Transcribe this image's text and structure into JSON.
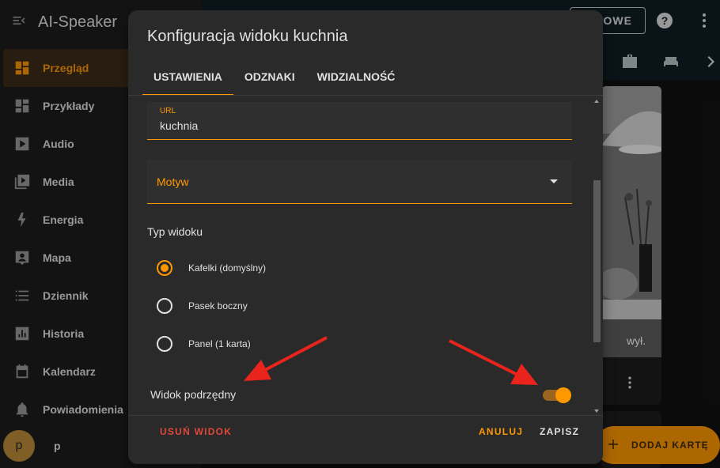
{
  "app": {
    "title": "AI-Speaker",
    "menu_icon": "menu-open-icon"
  },
  "sidebar": {
    "items": [
      {
        "label": "Przegląd",
        "icon": "dashboard-icon",
        "active": true
      },
      {
        "label": "Przykłady",
        "icon": "dashboard-icon"
      },
      {
        "label": "Audio",
        "icon": "play-icon"
      },
      {
        "label": "Media",
        "icon": "media-library-icon"
      },
      {
        "label": "Energia",
        "icon": "lightning-icon"
      },
      {
        "label": "Mapa",
        "icon": "account-box-icon"
      },
      {
        "label": "Dziennik",
        "icon": "list-icon"
      },
      {
        "label": "Historia",
        "icon": "chart-icon"
      },
      {
        "label": "Kalendarz",
        "icon": "calendar-icon"
      },
      {
        "label": "Powiadomienia",
        "icon": "bell-icon"
      }
    ],
    "user": {
      "initial": "p",
      "name": "p"
    }
  },
  "topbar": {
    "done_label": "GOTOWE",
    "help_icon": "help-icon",
    "more_icon": "more-vert-icon",
    "view_icons": [
      "briefcase-icon",
      "sofa-icon",
      "chevron-right-icon"
    ]
  },
  "card": {
    "status": "wył."
  },
  "fab": {
    "label": "DODAJ KARTĘ"
  },
  "dialog": {
    "title": "Konfiguracja widoku kuchnia",
    "tabs": [
      {
        "label": "USTAWIENIA",
        "active": true
      },
      {
        "label": "ODZNAKI"
      },
      {
        "label": "WIDZIALNOŚĆ"
      }
    ],
    "url_field": {
      "label": "URL",
      "value": "kuchnia"
    },
    "theme_field": {
      "label": "Motyw"
    },
    "view_type": {
      "label": "Typ widoku",
      "options": [
        {
          "label": "Kafelki (domyślny)",
          "checked": true
        },
        {
          "label": "Pasek boczny",
          "checked": false
        },
        {
          "label": "Panel (1 karta)",
          "checked": false
        }
      ]
    },
    "subview": {
      "label": "Widok podrzędny",
      "enabled": true
    },
    "actions": {
      "delete": "USUŃ WIDOK",
      "cancel": "ANULUJ",
      "save": "ZAPISZ"
    }
  },
  "colors": {
    "accent": "#ff9800",
    "danger": "#e1483a",
    "dialog_bg": "#2a2a2a",
    "annotation_arrow": "#e8241c"
  }
}
